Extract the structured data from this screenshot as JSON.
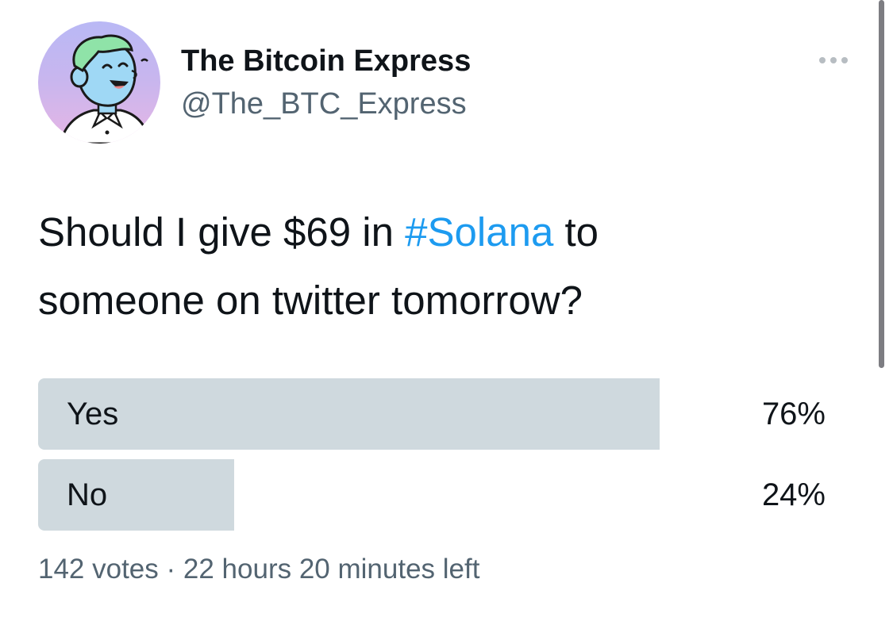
{
  "author": {
    "display_name": "The Bitcoin Express",
    "handle": "@The_BTC_Express",
    "avatar_icon": "cartoon-character-avatar"
  },
  "menu": {
    "more_icon": "ellipsis-icon"
  },
  "tweet": {
    "text_part_1": "Should I give $69 in ",
    "hashtag": "#Solana",
    "text_part_2": " to",
    "text_line_2": "someone on twitter tomorrow?"
  },
  "poll": {
    "options": [
      {
        "label": "Yes",
        "percent_text": "76%",
        "percent": 76
      },
      {
        "label": "No",
        "percent_text": "24%",
        "percent": 24
      }
    ],
    "votes": "142 votes",
    "separator": "·",
    "time_left": "22 hours 20 minutes left"
  },
  "colors": {
    "hashtag": "#1d9bf0",
    "poll_bar": "#cfd9de",
    "secondary_text": "#536471"
  }
}
